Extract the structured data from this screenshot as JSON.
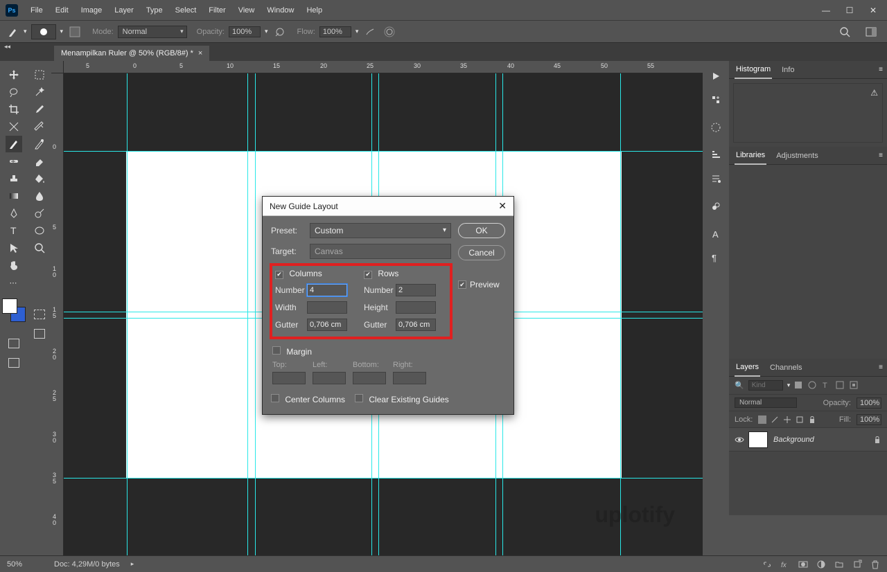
{
  "app": {
    "logo": "Ps",
    "title": "Adobe Photoshop"
  },
  "menu": [
    "File",
    "Edit",
    "Image",
    "Layer",
    "Type",
    "Select",
    "Filter",
    "View",
    "Window",
    "Help"
  ],
  "options": {
    "mode_label": "Mode:",
    "mode_value": "Normal",
    "opacity_label": "Opacity:",
    "opacity_value": "100%",
    "flow_label": "Flow:",
    "flow_value": "100%"
  },
  "doc_tab": {
    "title": "Menampilkan Ruler @ 50% (RGB/8#) *"
  },
  "ruler": {
    "h": [
      "5",
      "10",
      "15",
      "20",
      "25",
      "30",
      "35",
      "40",
      "45",
      "50",
      "55"
    ],
    "zero": "0",
    "v": [
      "0",
      "5",
      "1 0",
      "1 5",
      "2 0",
      "2 5",
      "3 0",
      "3 5",
      "4 0"
    ]
  },
  "panels": {
    "histogram": "Histogram",
    "info": "Info",
    "libraries": "Libraries",
    "adjustments": "Adjustments",
    "layers": "Layers",
    "channels": "Channels"
  },
  "layers": {
    "kind_placeholder": "Kind",
    "blend": "Normal",
    "opacity_label": "Opacity:",
    "opacity": "100%",
    "lock_label": "Lock:",
    "fill_label": "Fill:",
    "fill": "100%",
    "item": "Background"
  },
  "status": {
    "zoom": "50%",
    "doc": "Doc: 4,29M/0 bytes"
  },
  "dialog": {
    "title": "New Guide Layout",
    "ok": "OK",
    "cancel": "Cancel",
    "preset_label": "Preset:",
    "preset_value": "Custom",
    "target_label": "Target:",
    "target_value": "Canvas",
    "preview": "Preview",
    "columns": {
      "header": "Columns",
      "number_label": "Number",
      "number": "4",
      "width_label": "Width",
      "width": "",
      "gutter_label": "Gutter",
      "gutter": "0,706 cm"
    },
    "rows": {
      "header": "Rows",
      "number_label": "Number",
      "number": "2",
      "height_label": "Height",
      "height": "",
      "gutter_label": "Gutter",
      "gutter": "0,706 cm"
    },
    "margin": {
      "header": "Margin",
      "top": "Top:",
      "left": "Left:",
      "bottom": "Bottom:",
      "right": "Right:"
    },
    "center_columns": "Center Columns",
    "clear_existing": "Clear Existing Guides"
  },
  "watermark": "uplotify"
}
